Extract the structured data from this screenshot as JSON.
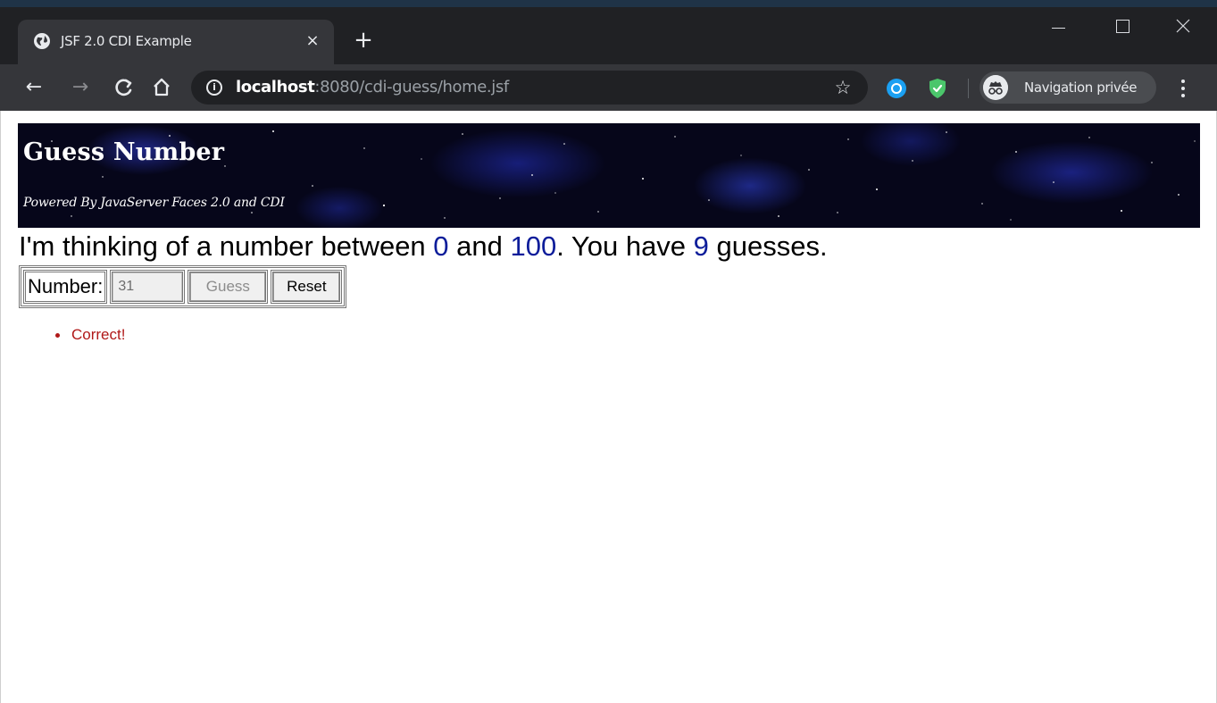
{
  "browser": {
    "tab": {
      "title": "JSF 2.0 CDI Example",
      "close_glyph": "×",
      "favicon": "globe-icon"
    },
    "new_tab_glyph": "+",
    "nav": {
      "back_glyph": "←",
      "forward_glyph": "→",
      "reload_glyph": "C",
      "home_glyph": "⌂"
    },
    "address": {
      "info_glyph": "i",
      "host": "localhost",
      "rest": ":8080/cdi-guess/home.jsf"
    },
    "bookmark_glyph": "☆",
    "extensions": [
      "blue-circle-extension-icon",
      "green-shield-extension-icon"
    ],
    "profile": {
      "label": "Navigation privée",
      "icon": "incognito-icon"
    },
    "colors": {
      "frame": "#202124",
      "toolbar": "#35363a",
      "omnibox": "#202124"
    }
  },
  "page": {
    "banner": {
      "title": "Guess Number",
      "subtitle": "Powered By JavaServer Faces 2.0 and CDI"
    },
    "prompt": {
      "part1": "I'm thinking of a number between ",
      "min": "0",
      "part2": " and ",
      "max": "100",
      "part3": ". You have ",
      "remaining": "9",
      "part4": " guesses."
    },
    "form": {
      "label": "Number:",
      "input_value": "31",
      "guess_label": "Guess",
      "reset_label": "Reset",
      "guess_disabled": true
    },
    "messages": [
      "Correct!"
    ],
    "colors": {
      "number_accent": "#0d1d9a",
      "message": "#b01818"
    }
  }
}
